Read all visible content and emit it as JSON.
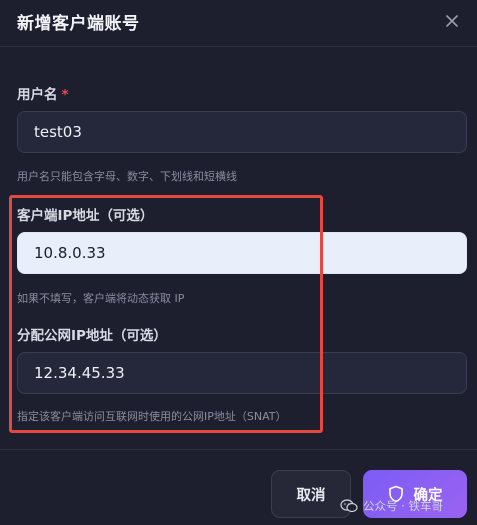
{
  "dialog": {
    "title": "新增客户端账号",
    "close_icon": "close-icon"
  },
  "fields": {
    "username": {
      "label": "用户名",
      "required_mark": "*",
      "value": "test03",
      "hint": "用户名只能包含字母、数字、下划线和短横线"
    },
    "client_ip": {
      "label": "客户端IP地址（可选）",
      "value": "10.8.0.33",
      "hint": "如果不填写，客户端将动态获取 IP"
    },
    "public_ip": {
      "label": "分配公网IP地址（可选）",
      "value": "12.34.45.33",
      "hint": "指定该客户端访问互联网时使用的公网IP地址（SNAT）"
    }
  },
  "buttons": {
    "cancel_label": "取消",
    "confirm_label": "确定",
    "confirm_icon": "shield-icon"
  },
  "watermark": {
    "text": "公众号 · 铁车哥",
    "icon": "wechat-icon"
  },
  "colors": {
    "background": "#1e1f2e",
    "accent": "#8b5cf6",
    "required": "#ef4a4a",
    "highlight_box": "#e5483f"
  }
}
